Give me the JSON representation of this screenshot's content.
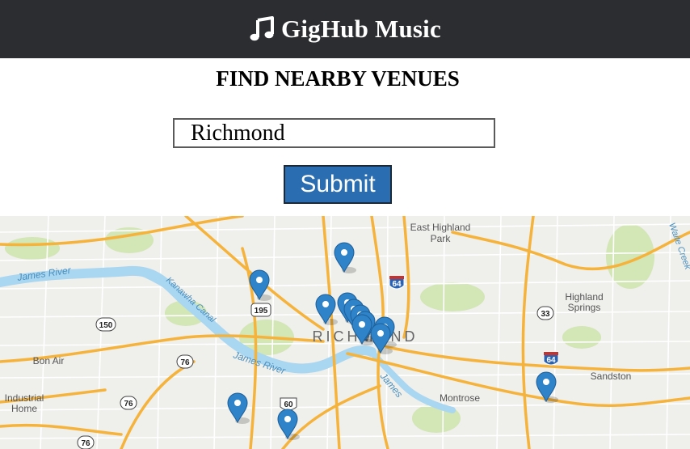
{
  "header": {
    "icon": "music-note-icon",
    "title": "GigHub Music"
  },
  "search": {
    "heading": "FIND NEARBY VENUES",
    "value": "Richmond",
    "submit_label": "Submit"
  },
  "map": {
    "city_label": "RICHMOND",
    "places": {
      "east_highland_park_1": "East Highland",
      "east_highland_park_2": "Park",
      "highland_springs_1": "Highland",
      "highland_springs_2": "Springs",
      "sandston": "Sandston",
      "bon_air": "Bon Air",
      "industrial_home_1": "Industrial",
      "industrial_home_2": "Home",
      "montrose": "Montrose",
      "james_river": "James River",
      "james_river_west": "James River",
      "james_river_east": "James",
      "kanawha_canal": "Kanawha Canal",
      "white_creek": "Waite Creek"
    },
    "shields": {
      "i64_north": "64",
      "i64_east": "64",
      "i195": "195",
      "rt150": "150",
      "rt76_a": "76",
      "rt76_b": "76",
      "rt76_c": "76",
      "rt33": "33",
      "us60": "60"
    },
    "marker_count": 13,
    "colors": {
      "marker": "#2f83c9",
      "road": "#f5b33b",
      "water": "#a8d4ef",
      "park": "#cfe3b0"
    }
  }
}
